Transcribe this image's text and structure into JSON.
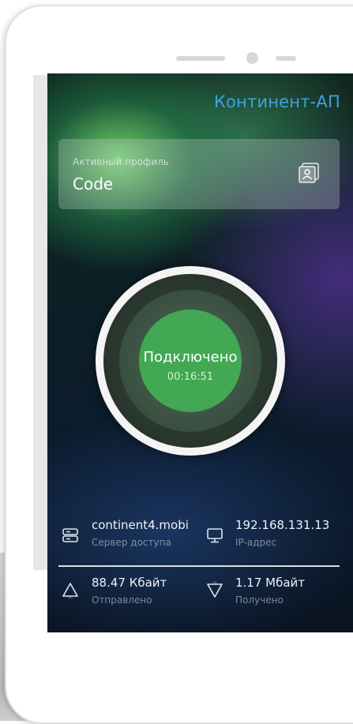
{
  "app": {
    "title": "Континент-АП"
  },
  "profile": {
    "label": "Активный профиль",
    "name": "Code"
  },
  "connection": {
    "status": "Подключено",
    "timer": "00:16:51"
  },
  "stats": {
    "server": {
      "value": "continent4.mobi",
      "label": "Сервер доступа",
      "icon": "server-icon"
    },
    "ip": {
      "value": "192.168.131.13",
      "label": "IP-адрес",
      "icon": "monitor-icon"
    },
    "sent": {
      "value": "88.47 Кбайт",
      "label": "Отправлено",
      "icon": "upload-triangle-icon"
    },
    "received": {
      "value": "1.17 Мбайт",
      "label": "Получено",
      "icon": "download-triangle-icon"
    }
  },
  "colors": {
    "accent": "#3da3dc",
    "connected": "#42a853"
  }
}
